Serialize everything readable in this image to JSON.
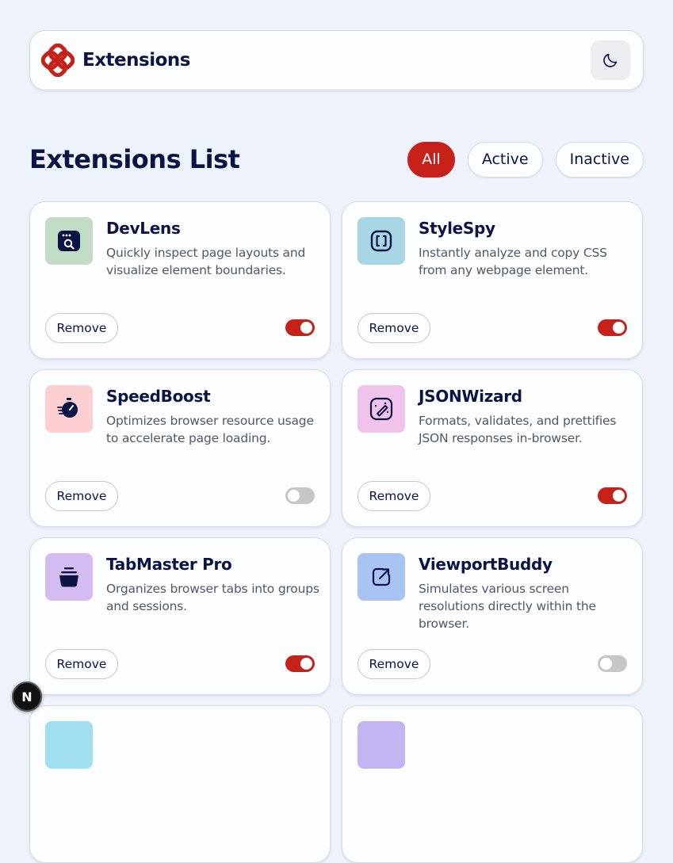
{
  "header": {
    "brand_name": "Extensions",
    "theme_toggle_icon": "moon-icon",
    "logo_color": "#c7221a"
  },
  "list": {
    "title": "Extensions List",
    "filters": [
      {
        "label": "All",
        "selected": true
      },
      {
        "label": "Active",
        "selected": false
      },
      {
        "label": "Inactive",
        "selected": false
      }
    ]
  },
  "accent_color": "#c7221a",
  "extensions": [
    {
      "name": "DevLens",
      "description": "Quickly inspect page layouts and visualize element boundaries.",
      "icon": "devlens-icon",
      "icon_bg": "#c3dcc4",
      "active": true,
      "remove_label": "Remove"
    },
    {
      "name": "StyleSpy",
      "description": "Instantly analyze and copy CSS from any webpage element.",
      "icon": "stylespy-icon",
      "icon_bg": "#a8d6e4",
      "active": true,
      "remove_label": "Remove"
    },
    {
      "name": "SpeedBoost",
      "description": "Optimizes browser resource usage to accelerate page loading.",
      "icon": "speedboost-icon",
      "icon_bg": "#fcd0d1",
      "active": false,
      "remove_label": "Remove"
    },
    {
      "name": "JSONWizard",
      "description": "Formats, validates, and prettifies JSON responses in-browser.",
      "icon": "jsonwizard-icon",
      "icon_bg": "#efc3ea",
      "active": true,
      "remove_label": "Remove"
    },
    {
      "name": "TabMaster Pro",
      "description": "Organizes browser tabs into groups and sessions.",
      "icon": "tabmaster-icon",
      "icon_bg": "#d3bdf0",
      "active": true,
      "remove_label": "Remove"
    },
    {
      "name": "ViewportBuddy",
      "description": "Simulates various screen resolutions directly within the browser.",
      "icon": "viewportbuddy-icon",
      "icon_bg": "#a9c4f3",
      "active": false,
      "remove_label": "Remove"
    }
  ],
  "dev_badge": {
    "label": "N"
  }
}
